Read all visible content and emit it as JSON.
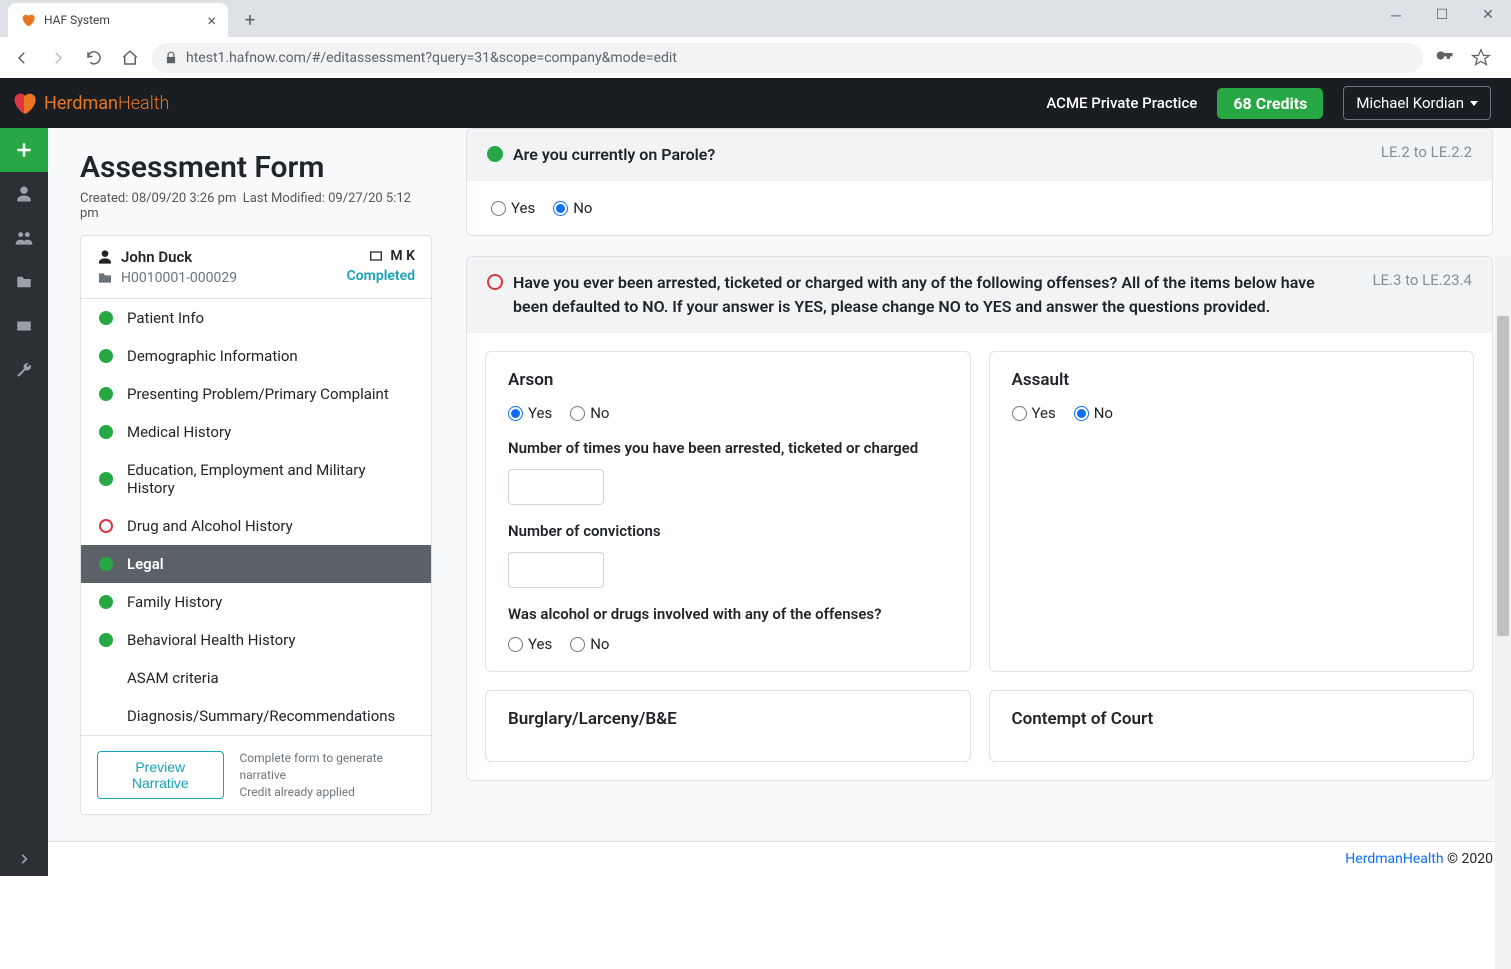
{
  "browser": {
    "tab_title": "HAF System",
    "url": "htest1.hafnow.com/#/editassessment?query=31&scope=company&mode=edit"
  },
  "header": {
    "brand_a": "Herdman",
    "brand_b": "Health",
    "practice": "ACME Private Practice",
    "credits": "68 Credits",
    "user": "Michael Kordian"
  },
  "sidebar": {
    "title": "Assessment Form",
    "created_label": "Created: 08/09/20 3:26 pm",
    "modified_label": "Last Modified: 09/27/20 5:12 pm",
    "patient_name": "John Duck",
    "patient_id": "H0010001-000029",
    "mk": "M K",
    "status": "Completed",
    "sections": [
      {
        "label": "Patient Info",
        "dot": "green"
      },
      {
        "label": "Demographic Information",
        "dot": "green"
      },
      {
        "label": "Presenting Problem/Primary Complaint",
        "dot": "green"
      },
      {
        "label": "Medical History",
        "dot": "green"
      },
      {
        "label": "Education, Employment and Military History",
        "dot": "green"
      },
      {
        "label": "Drug and Alcohol History",
        "dot": "red"
      },
      {
        "label": "Legal",
        "dot": "green",
        "active": true
      },
      {
        "label": "Family History",
        "dot": "green"
      },
      {
        "label": "Behavioral Health History",
        "dot": "green"
      },
      {
        "label": "ASAM criteria",
        "dot": "none"
      },
      {
        "label": "Diagnosis/Summary/Recommendations",
        "dot": "none"
      }
    ],
    "preview_btn": "Preview Narrative",
    "narrative_hint_1": "Complete form to generate narrative",
    "narrative_hint_2": "Credit already applied"
  },
  "questions": {
    "parole": {
      "text": "Are you currently on Parole?",
      "code": "LE.2 to LE.2.2",
      "yes": "Yes",
      "no": "No"
    },
    "offenses": {
      "text": "Have you ever been arrested, ticketed or charged with any of the following offenses? All of the items below have been defaulted to NO. If your answer is YES, please change NO to YES and answer the questions provided.",
      "code": "LE.3 to LE.23.4"
    }
  },
  "offense_cards": {
    "arson": {
      "title": "Arson",
      "q_times": "Number of times you have been arrested, ticketed or charged",
      "q_conv": "Number of convictions",
      "q_alcdrug": "Was alcohol or drugs involved with any of the offenses?"
    },
    "assault": {
      "title": "Assault"
    },
    "burglary": {
      "title": "Burglary/Larceny/B&E"
    },
    "contempt": {
      "title": "Contempt of Court"
    }
  },
  "labels": {
    "yes": "Yes",
    "no": "No"
  },
  "footer": {
    "brand": "HerdmanHealth",
    "copy": " © 2020"
  }
}
